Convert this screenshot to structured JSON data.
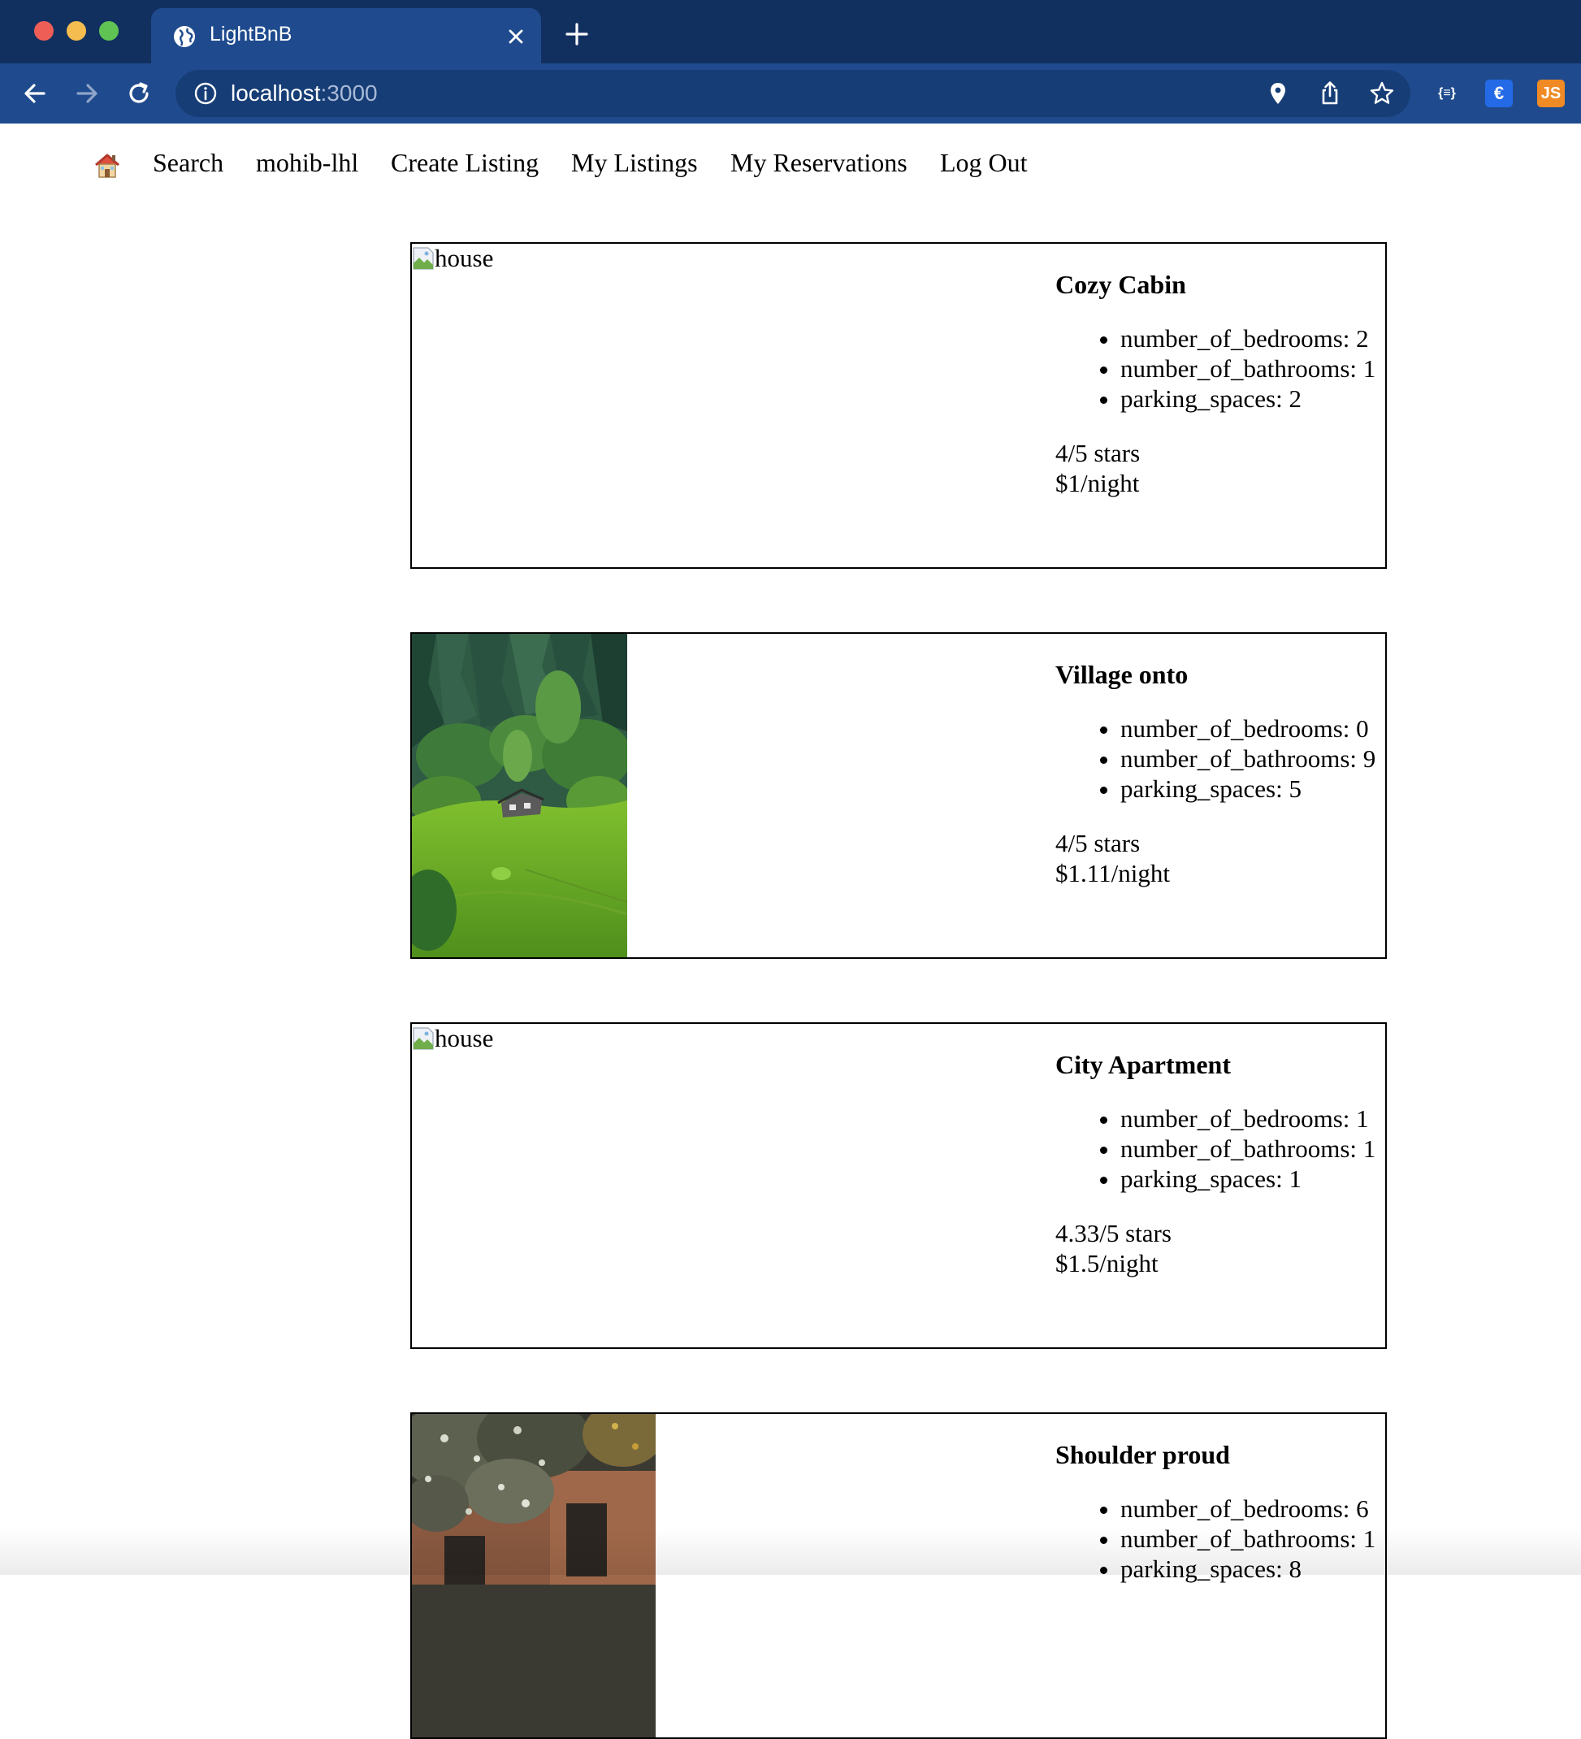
{
  "browser": {
    "tab_title": "LightBnB",
    "url_host": "localhost",
    "url_port": ":3000",
    "extensions": {
      "json_label": "{≡}",
      "euro_label": "€",
      "js_label": "JS"
    },
    "colors": {
      "tabbar": "#12305f",
      "toolbar": "#1f4b8e",
      "omnibox": "#163d76"
    }
  },
  "nav": {
    "home_icon": "house-emoji",
    "search": "Search",
    "username": "mohib-lhl",
    "create_listing": "Create Listing",
    "my_listings": "My Listings",
    "my_reservations": "My Reservations",
    "log_out": "Log Out"
  },
  "listings": [
    {
      "image_alt": "house",
      "image_state": "broken",
      "title": "Cozy Cabin",
      "bedrooms": "number_of_bedrooms: 2",
      "bathrooms": "number_of_bathrooms: 1",
      "parking": "parking_spaces: 2",
      "rating": "4/5 stars",
      "price": "$1/night"
    },
    {
      "image_alt": "house",
      "image_state": "forest-hillside-photo",
      "title": "Village onto",
      "bedrooms": "number_of_bedrooms: 0",
      "bathrooms": "number_of_bathrooms: 9",
      "parking": "parking_spaces: 5",
      "rating": "4/5 stars",
      "price": "$1.11/night"
    },
    {
      "image_alt": "house",
      "image_state": "broken",
      "title": "City Apartment",
      "bedrooms": "number_of_bedrooms: 1",
      "bathrooms": "number_of_bathrooms: 1",
      "parking": "parking_spaces: 1",
      "rating": "4.33/5 stars",
      "price": "$1.5/night"
    },
    {
      "image_alt": "house",
      "image_state": "flowering-tree-house-photo",
      "title": "Shoulder proud",
      "bedrooms": "number_of_bedrooms: 6",
      "bathrooms": "number_of_bathrooms: 1",
      "parking": "parking_spaces: 8"
    }
  ]
}
